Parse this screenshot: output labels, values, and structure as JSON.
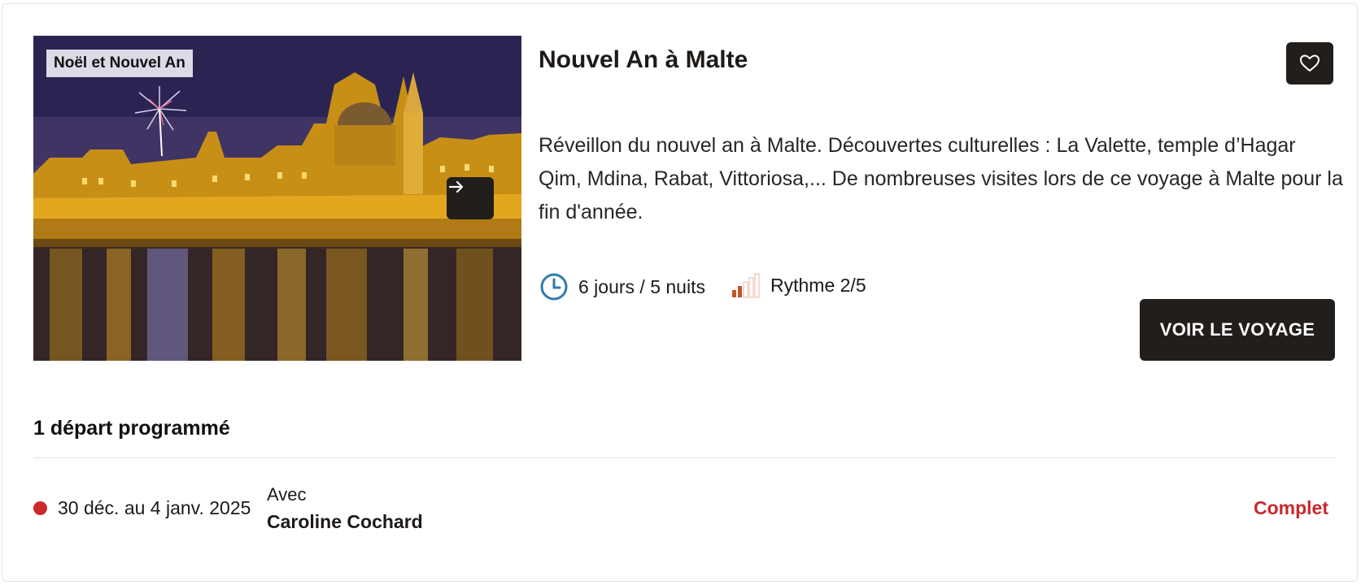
{
  "trip": {
    "tag": "Noël et Nouvel An",
    "title": "Nouvel An à Malte",
    "description": "Réveillon du nouvel an à Malte. Découvertes culturelles : La Valette, temple d’Hagar Qim, Mdina, Rabat, Vittoriosa,... De nombreuses visites lors de ce voyage à Malte pour la fin d'année.",
    "duration": "6 jours / 5 nuits",
    "rythme": "Rythme 2/5",
    "rythme_level": 2,
    "rythme_max": 5,
    "cta_label": "VOIR LE VOYAGE",
    "image_icon": "city-night-photo",
    "arrow_icon": "arrow-right-icon",
    "favorite_icon": "heart-icon",
    "duration_icon": "clock-icon",
    "rythme_icon": "rythme-bars-icon"
  },
  "departures": {
    "title": "1 départ programmé",
    "items": [
      {
        "dates": "30 déc. au 4 janv. 2025",
        "with_label": "Avec",
        "guide": "Caroline Cochard",
        "status": "Complet",
        "status_color": "#c8282b"
      }
    ]
  },
  "colors": {
    "dark": "#221e1c",
    "accent_red": "#c8282b",
    "clock_blue": "#2f7cab",
    "rythme_orange": "#c0562a"
  }
}
